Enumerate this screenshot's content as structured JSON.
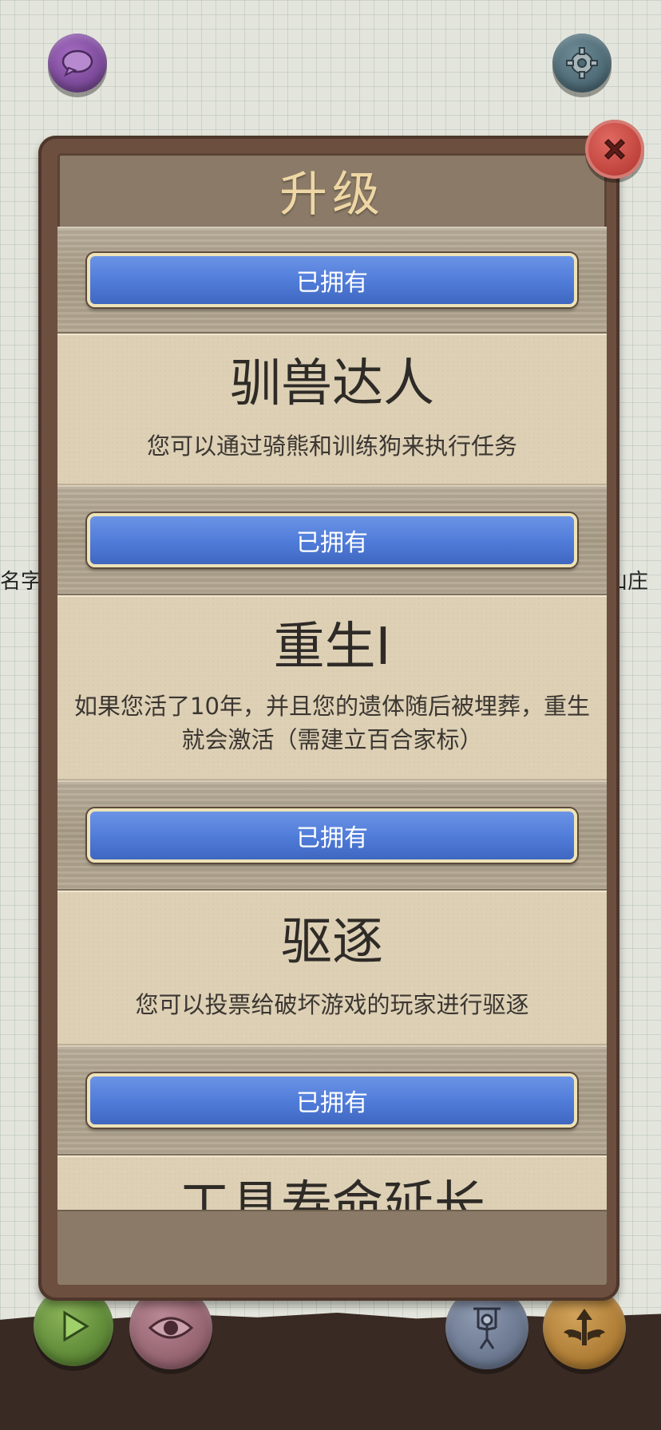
{
  "background": {
    "left_partial_text": "名字",
    "right_partial_text": "山庄"
  },
  "top_buttons": {
    "chat_icon": "chat-bubble-icon",
    "settings_icon": "gear-icon"
  },
  "dialog": {
    "title": "升级",
    "close_icon": "close-icon",
    "owned_label": "已拥有",
    "upgrades": [
      {
        "title": "驯兽达人",
        "description": "您可以通过骑熊和训练狗来执行任务"
      },
      {
        "title": "重生I",
        "description": "如果您活了10年，并且您的遗体随后被埋葬，重生就会激活（需建立百合家标）"
      },
      {
        "title": "驱逐",
        "description": "您可以投票给破坏游戏的玩家进行驱逐"
      },
      {
        "title": "工具寿命延长",
        "description": ""
      }
    ]
  },
  "bottom_buttons": {
    "play_icon": "play-icon",
    "eye_icon": "eye-icon",
    "puppet_icon": "puppet-icon",
    "wings_icon": "winged-arrow-icon"
  },
  "colors": {
    "owned_button": "#4f7bd8",
    "close_button": "#c2463f",
    "frame": "#6d4f40",
    "title_text": "#efd7a5"
  }
}
